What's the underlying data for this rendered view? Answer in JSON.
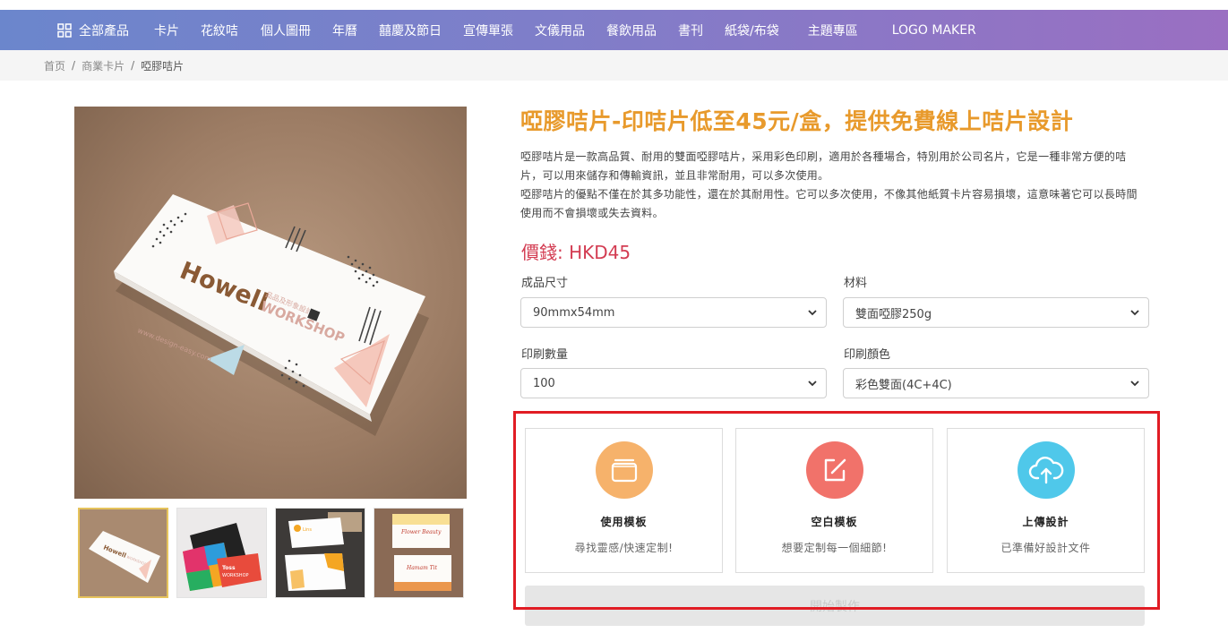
{
  "nav": {
    "items": [
      {
        "label": "全部產品"
      },
      {
        "label": "卡片"
      },
      {
        "label": "花紋咭"
      },
      {
        "label": "個人圖冊"
      },
      {
        "label": "年曆"
      },
      {
        "label": "囍慶及節日"
      },
      {
        "label": "宣傳單張"
      },
      {
        "label": "文儀用品"
      },
      {
        "label": "餐飲用品"
      },
      {
        "label": "書刊"
      },
      {
        "label": "紙袋/布袋"
      },
      {
        "label": "主題專區"
      },
      {
        "label": "LOGO MAKER"
      }
    ],
    "icon": "grid-icon"
  },
  "breadcrumb": {
    "items": [
      "首页",
      "商業卡片",
      "啞膠咭片"
    ],
    "separator": "/"
  },
  "gallery": {
    "main_card": {
      "brand": "Howell",
      "workshop": "WORKSHOP",
      "tagline": "品品及形象設計",
      "website": "www.design-easy.com"
    },
    "thumbnails": [
      {
        "brand": "Howell",
        "sub": "WORKSHOP"
      },
      {
        "brand": "Toss",
        "sub": "WORKSHOP"
      },
      {
        "brand": "Lins"
      },
      {
        "brand": "Flower Beauty",
        "sub": "Hamam Tit"
      }
    ]
  },
  "product": {
    "title": "啞膠咭片-印咭片低至45元/盒，提供免費線上咭片設計",
    "description": [
      "啞膠咭片是一款高品質、耐用的雙面啞膠咭片，采用彩色印刷，適用於各種場合，特別用於公司名片，它是一種非常方便的咭片，可以用來儲存和傳輸資訊，並且非常耐用，可以多次使用。",
      "啞膠咭片的優點不僅在於其多功能性，還在於其耐用性。它可以多次使用，不像其他紙質卡片容易損壞，這意味著它可以長時間使用而不會損壞或失去資料。"
    ],
    "price_label": "價錢: ",
    "price_value": "HKD45"
  },
  "options": {
    "size": {
      "label": "成品尺寸",
      "value": "90mmx54mm"
    },
    "material": {
      "label": "材料",
      "value": "雙面啞膠250g"
    },
    "quantity": {
      "label": "印刷數量",
      "value": "100"
    },
    "color": {
      "label": "印刷顏色",
      "value": "彩色雙面(4C+4C)"
    }
  },
  "design_choices": [
    {
      "title": "使用模板",
      "subtitle": "尋找靈感/快速定制!",
      "icon": "template-icon",
      "color": "#f6b26b"
    },
    {
      "title": "空白模板",
      "subtitle": "想要定制每一個細節!",
      "icon": "edit-icon",
      "color": "#f1726a"
    },
    {
      "title": "上傳設計",
      "subtitle": "已準備好設計文件",
      "icon": "cloud-upload-icon",
      "color": "#4fc8ea"
    }
  ],
  "start_button": {
    "label": "開始製作"
  },
  "colors": {
    "accent_orange": "#e89a2c",
    "price_red": "#d33c52",
    "highlight_red": "#e11c24",
    "nav_gradient_start": "#6b86cc",
    "nav_gradient_end": "#9a6fc2"
  }
}
